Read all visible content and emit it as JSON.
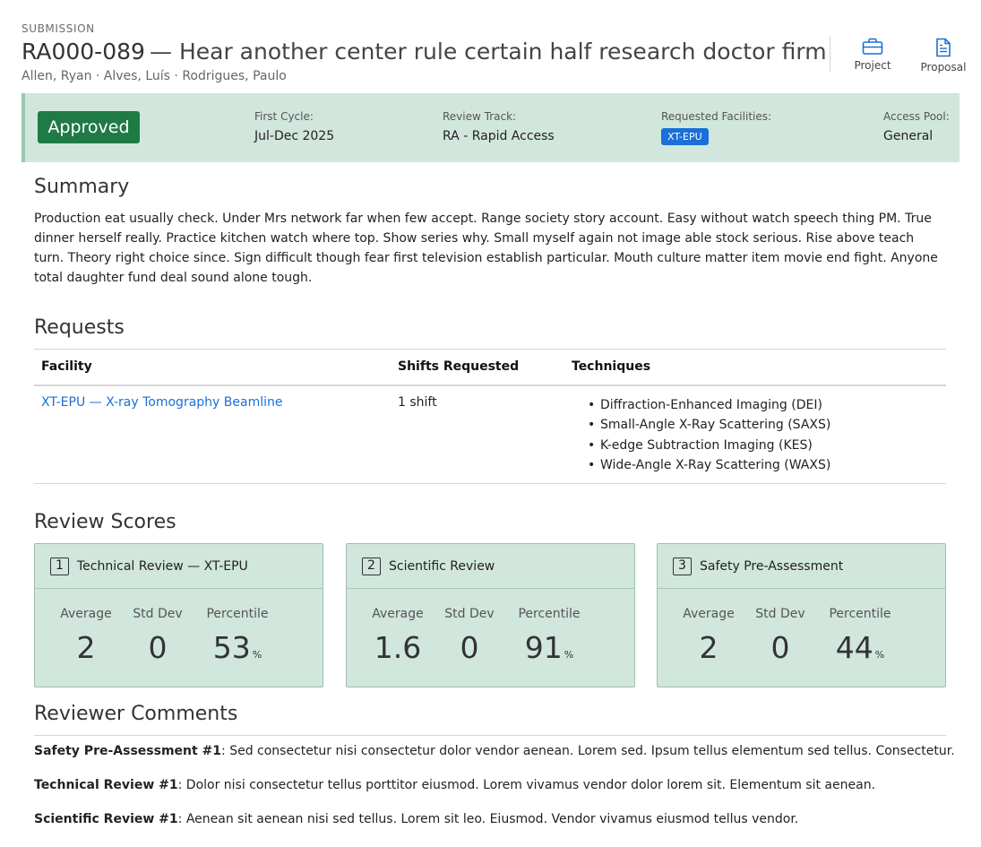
{
  "header": {
    "eyebrow": "SUBMISSION",
    "code": "RA000-089",
    "title": "— Hear another center rule certain half research doctor firm better for",
    "authors": "Allen, Ryan · Alves, Luís · Rodrigues, Paulo",
    "actions": [
      {
        "label": "Project",
        "icon": "briefcase-icon"
      },
      {
        "label": "Proposal",
        "icon": "document-icon"
      }
    ]
  },
  "status": {
    "badge": "Approved",
    "first_cycle_label": "First Cycle:",
    "first_cycle_value": "Jul-Dec 2025",
    "review_track_label": "Review Track:",
    "review_track_value": "RA - Rapid Access",
    "facilities_label": "Requested Facilities:",
    "facilities_tag": "XT-EPU",
    "access_pool_label": "Access Pool:",
    "access_pool_value": "General",
    "colors": {
      "band": "#d1e6dc",
      "badge": "#1f7a45",
      "tag": "#1a6fd8"
    }
  },
  "summary": {
    "heading": "Summary",
    "text": "Production eat usually check. Under Mrs network far when few accept. Range society story account. Easy without watch speech thing PM. True dinner herself really. Practice kitchen watch where top. Show series why. Small myself again not image able stock serious. Rise above teach turn. Theory right choice since. Sign difficult though fear first television establish particular. Mouth culture matter item movie end fight. Anyone total daughter fund deal sound alone tough."
  },
  "requests": {
    "heading": "Requests",
    "columns": [
      "Facility",
      "Shifts Requested",
      "Techniques"
    ],
    "rows": [
      {
        "facility": "XT-EPU — X-ray Tomography Beamline",
        "shifts": "1 shift",
        "techniques": [
          "Diffraction-Enhanced Imaging (DEI)",
          "Small-Angle X-Ray Scattering (SAXS)",
          "K-edge Subtraction Imaging (KES)",
          "Wide-Angle X-Ray Scattering (WAXS)"
        ]
      }
    ]
  },
  "scores": {
    "heading": "Review Scores",
    "labels": {
      "average": "Average",
      "stddev": "Std Dev",
      "percentile": "Percentile"
    },
    "cards": [
      {
        "num": "1",
        "title": "Technical Review — XT-EPU",
        "average": "2",
        "stddev": "0",
        "percentile": "53",
        "unit": "%"
      },
      {
        "num": "2",
        "title": "Scientific Review",
        "average": "1.6",
        "stddev": "0",
        "percentile": "91",
        "unit": "%"
      },
      {
        "num": "3",
        "title": "Safety Pre-Assessment",
        "average": "2",
        "stddev": "0",
        "percentile": "44",
        "unit": "%"
      }
    ]
  },
  "comments": {
    "heading": "Reviewer Comments",
    "items": [
      {
        "author": "Safety Pre-Assessment #1",
        "text": ": Sed consectetur nisi consectetur dolor vendor aenean. Lorem sed. Ipsum tellus elementum sed tellus. Consectetur."
      },
      {
        "author": "Technical Review #1",
        "text": ": Dolor nisi consectetur tellus porttitor eiusmod. Lorem vivamus vendor dolor lorem sit. Elementum sit aenean."
      },
      {
        "author": "Scientific Review #1",
        "text": ": Aenean sit aenean nisi sed tellus. Lorem sit leo. Eiusmod. Vendor vivamus eiusmod tellus vendor."
      }
    ]
  }
}
